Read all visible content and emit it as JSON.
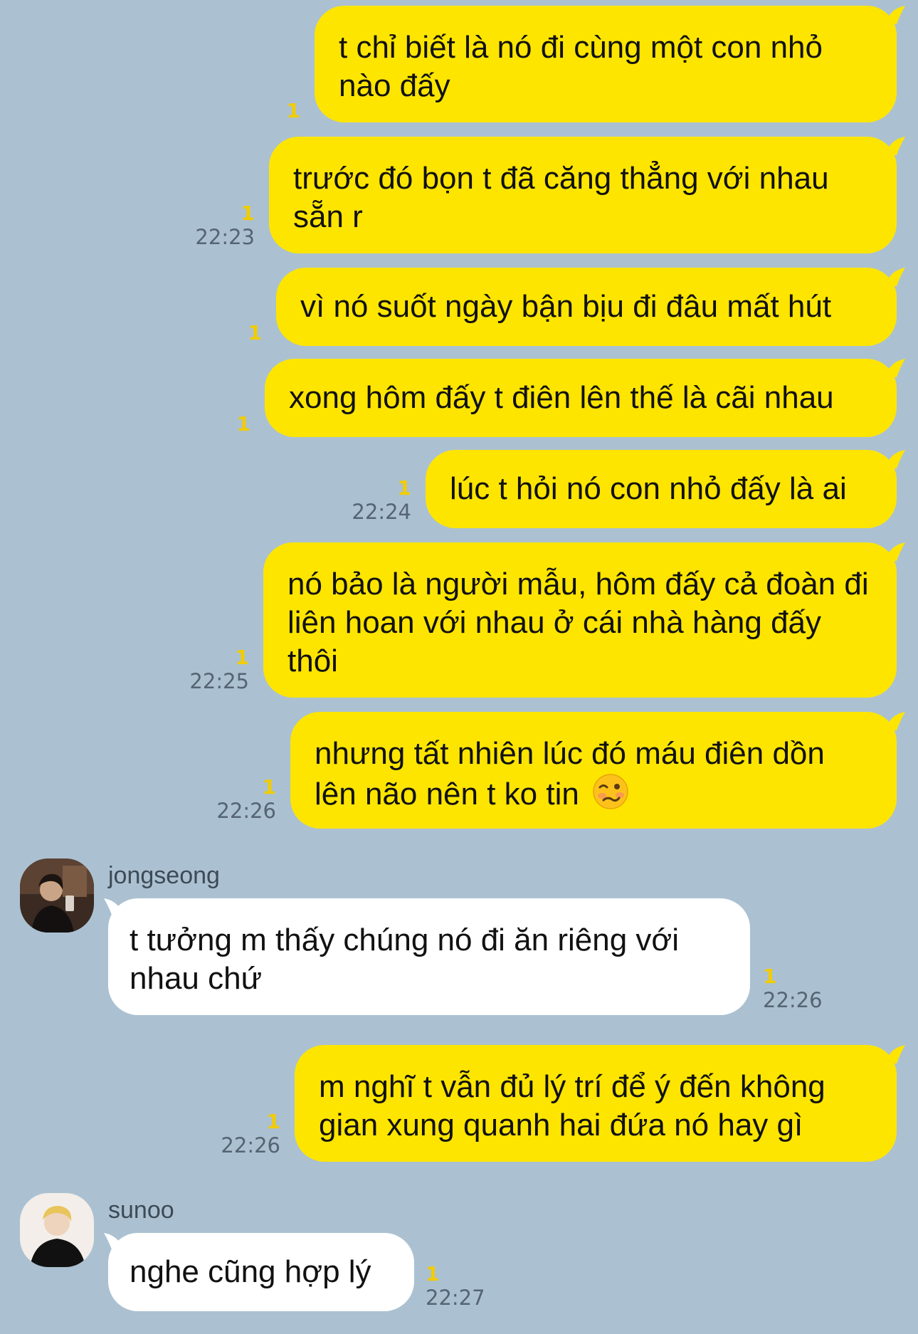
{
  "messages": [
    {
      "text": "t chỉ biết là nó đi cùng một con nhỏ nào đấy",
      "read": "1",
      "time": ""
    },
    {
      "text": "trước đó bọn t đã căng thẳng với nhau sẵn r",
      "read": "1",
      "time": "22:23"
    },
    {
      "text": "vì nó suốt ngày bận bịu đi đâu mất hút",
      "read": "1",
      "time": ""
    },
    {
      "text": "xong hôm đấy t điên lên thế là cãi nhau",
      "read": "1",
      "time": ""
    },
    {
      "text": "lúc t hỏi nó con nhỏ đấy là ai",
      "read": "1",
      "time": "22:24"
    },
    {
      "text": "nó bảo là người mẫu, hôm đấy cả đoàn đi liên hoan với nhau ở cái nhà hàng đấy thôi",
      "read": "1",
      "time": "22:25"
    },
    {
      "text": "nhưng tất nhiên lúc đó máu điên dồn lên não nên t ko tin",
      "emoji": "woozy-face-emoji",
      "read": "1",
      "time": "22:26"
    },
    {
      "sender": "jongseong",
      "text": "t tưởng m thấy chúng nó đi ăn riêng với nhau chứ",
      "read": "1",
      "time": "22:26"
    },
    {
      "text": "m nghĩ t vẫn đủ lý trí để ý đến không gian xung quanh hai đứa nó hay gì",
      "read": "1",
      "time": "22:26"
    },
    {
      "sender": "sunoo",
      "text": "nghe cũng hợp lý",
      "read": "1",
      "time": "22:27"
    }
  ],
  "colors": {
    "background": "#abc1d1",
    "outgoing_bubble": "#fee500",
    "incoming_bubble": "#ffffff",
    "read_count": "#f2cc00",
    "timestamp": "#556474"
  }
}
